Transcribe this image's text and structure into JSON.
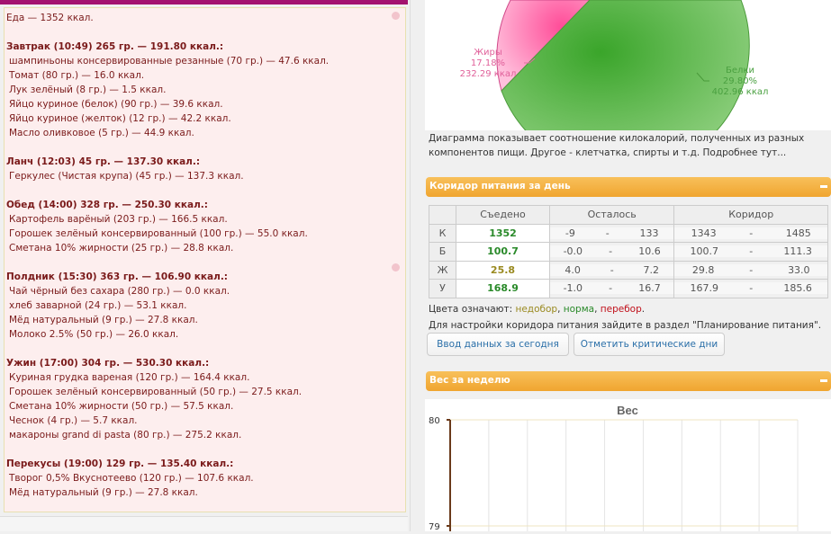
{
  "diary": {
    "total": "Еда — 1352 ккал.",
    "meals": [
      {
        "title": "Завтрак (10:49) 265 гр. — 191.80 ккал.:",
        "items": [
          "шампиньоны консервированные резанные (70 гр.) — 47.6 ккал.",
          "Томат (80 гр.) — 16.0 ккал.",
          "Лук зелёный (8 гр.) — 1.5 ккал.",
          "Яйцо куриное (белок) (90 гр.) — 39.6 ккал.",
          "Яйцо куриное (желток) (12 гр.) — 42.2 ккал.",
          "Масло оливковое (5 гр.) — 44.9 ккал."
        ]
      },
      {
        "title": "Ланч (12:03) 45 гр. — 137.30 ккал.:",
        "items": [
          "Геркулес (Чистая крупа) (45 гр.) — 137.3 ккал."
        ]
      },
      {
        "title": "Обед (14:00) 328 гр. — 250.30 ккал.:",
        "items": [
          "Картофель варёный (203 гр.) — 166.5 ккал.",
          "Горошек зелёный консервированный (100 гр.) — 55.0 ккал.",
          "Сметана 10% жирности (25 гр.) — 28.8 ккал."
        ]
      },
      {
        "title": "Полдник (15:30) 363 гр. — 106.90 ккал.:",
        "items": [
          "Чай чёрный без сахара (280 гр.) — 0.0 ккал.",
          "хлеб заварной (24 гр.) — 53.1 ккал.",
          "Мёд натуральный (9 гр.) — 27.8 ккал.",
          "Молоко 2.5% (50 гр.) — 26.0 ккал."
        ]
      },
      {
        "title": "Ужин (17:00) 304 гр. — 530.30 ккал.:",
        "items": [
          "Куриная грудка вареная (120 гр.) — 164.4 ккал.",
          "Горошек зелёный консервированный (50 гр.) — 27.5 ккал.",
          "Сметана 10% жирности (50 гр.) — 57.5 ккал.",
          "Чеснок (4 гр.) — 5.7 ккал.",
          "макароны grand di pasta (80 гр.) — 275.2 ккал."
        ]
      },
      {
        "title": "Перекусы (19:00) 129 гр. — 135.40 ккал.:",
        "items": [
          "Творог 0,5% Вкуснотеево (120 гр.) — 107.6 ккал.",
          "Мёд натуральный (9 гр.) — 27.8 ккал."
        ]
      }
    ]
  },
  "pie": {
    "fat": {
      "name": "Жиры",
      "pct": "17.18%",
      "kcal": "232.29 ккал",
      "color": "#ff5fa0"
    },
    "protein": {
      "name": "Белки",
      "pct": "29.80%",
      "kcal": "402.96 ккал",
      "color": "#4aac34"
    },
    "note": "Диаграмма показывает соотношение килокалорий, полученных из разных компонентов пищи. Другое - клетчатка, спирты и т.д. Подробнее тут..."
  },
  "corridor": {
    "title": "Коридор питания за день",
    "headers": [
      "Съедено",
      "Осталось",
      "Коридор"
    ],
    "rows": [
      {
        "label": "К",
        "eaten": "1352",
        "left_min": "-9",
        "left_max": "133",
        "min": "1343",
        "max": "1485",
        "status": "green"
      },
      {
        "label": "Б",
        "eaten": "100.7",
        "left_min": "-0.0",
        "left_max": "10.6",
        "min": "100.7",
        "max": "111.3",
        "status": "green"
      },
      {
        "label": "Ж",
        "eaten": "25.8",
        "left_min": "4.0",
        "left_max": "7.2",
        "min": "29.8",
        "max": "33.0",
        "status": "olive"
      },
      {
        "label": "У",
        "eaten": "168.9",
        "left_min": "-1.0",
        "left_max": "16.7",
        "min": "167.9",
        "max": "185.6",
        "status": "green"
      }
    ],
    "sep": "-",
    "legend_prefix": "Цвета означают:",
    "legend_under": "недобор",
    "legend_norm": "норма",
    "legend_over": "перебор",
    "settings_note": "Для настройки коридора питания зайдите в раздел \"Планирование питания\".",
    "btn_input": "Ввод данных за сегодня",
    "btn_critical": "Отметить критические дни"
  },
  "weight": {
    "title": "Вес за неделю"
  },
  "chart_data": {
    "type": "line",
    "title": "Вес",
    "ylabel": "",
    "xlabel": "",
    "y_ticks": [
      "80",
      "79"
    ],
    "ylim": [
      79,
      80
    ],
    "series": []
  }
}
